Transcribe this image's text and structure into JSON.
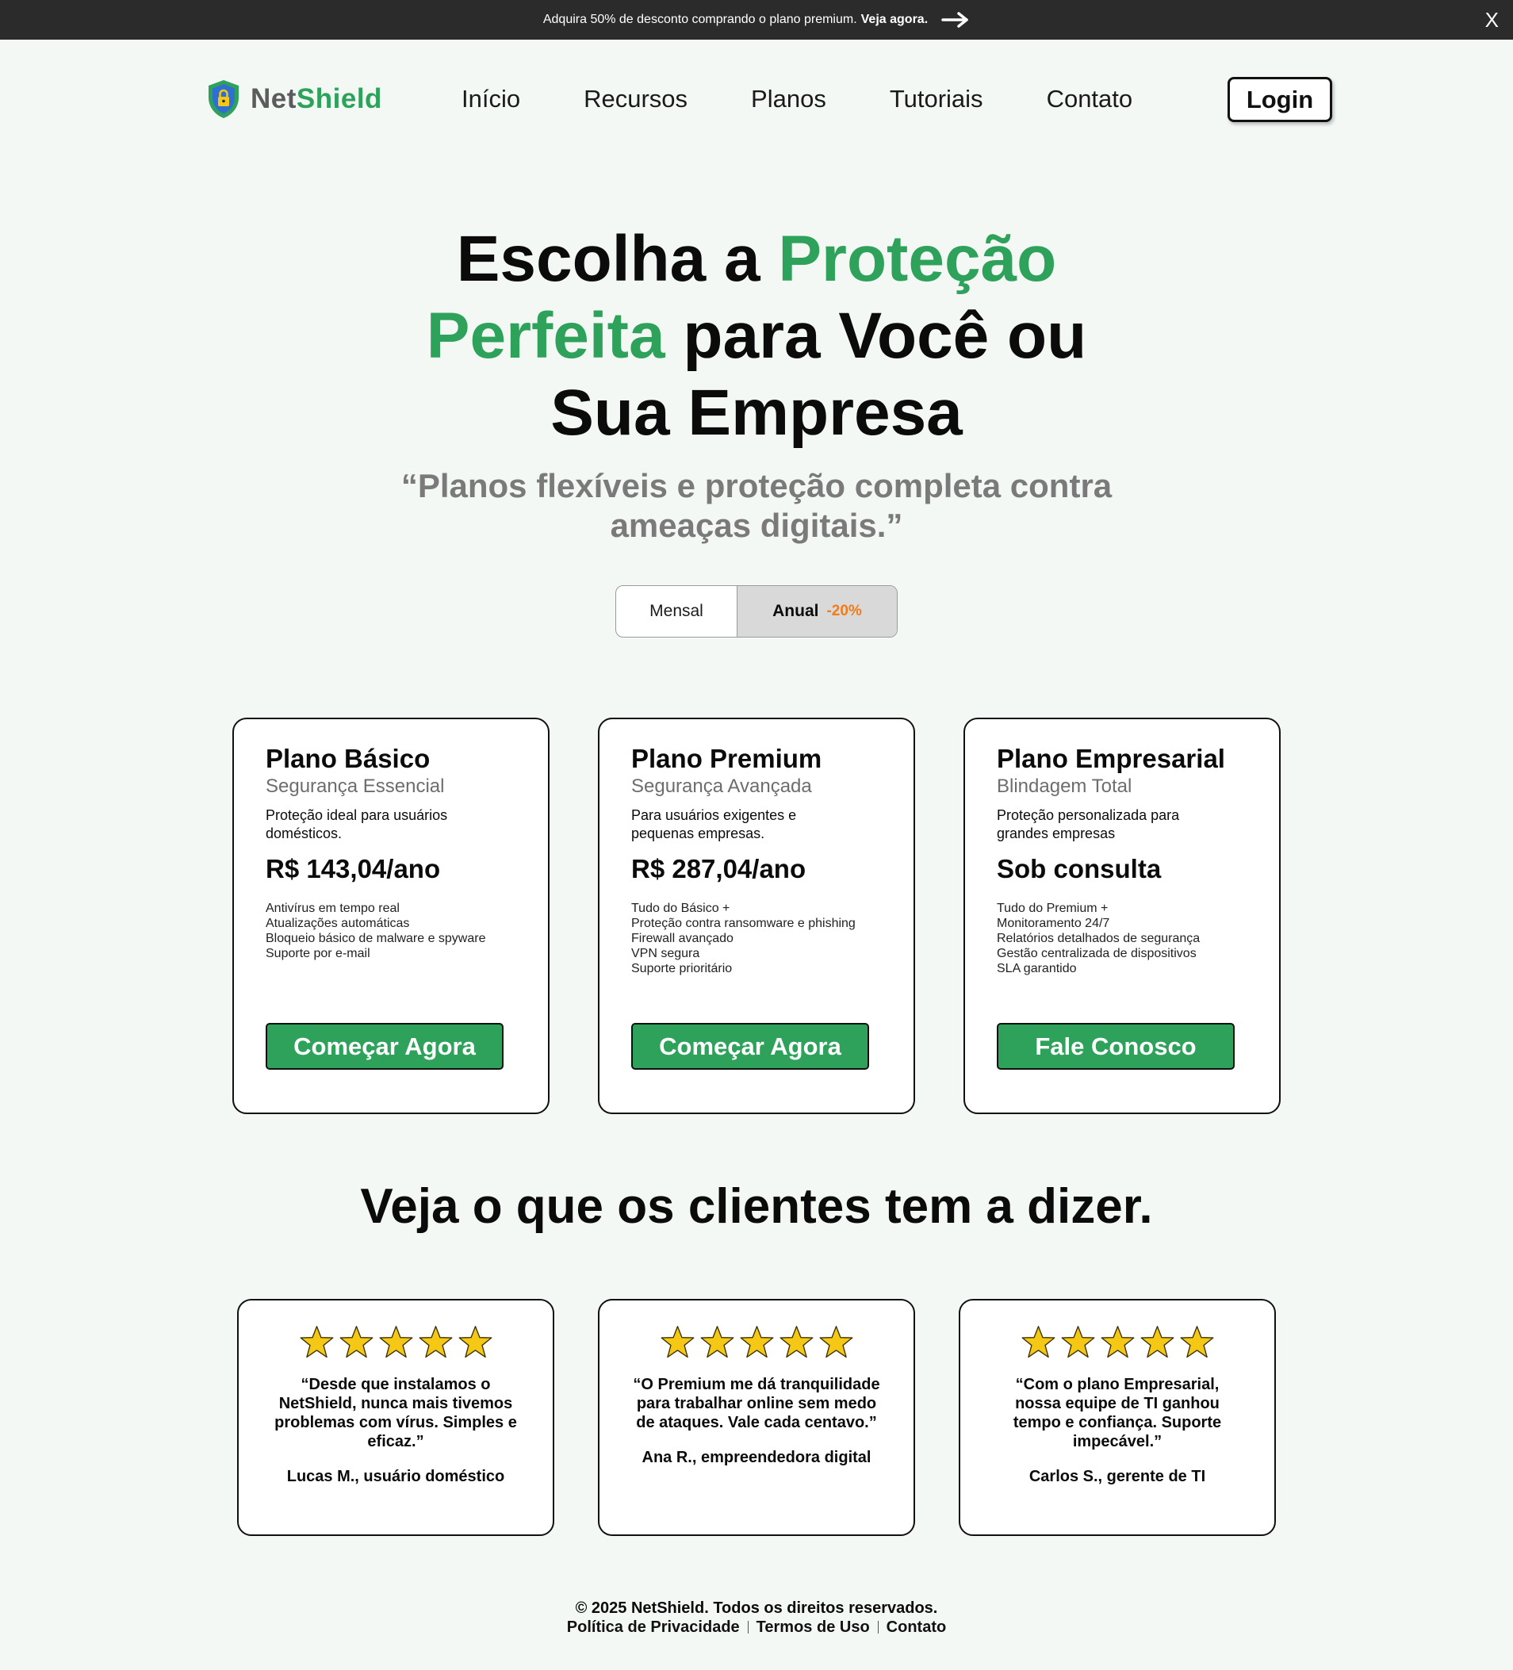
{
  "promo": {
    "text": "Adquira 50% de desconto comprando o plano premium.",
    "cta": "Veja agora.",
    "close_label": "X"
  },
  "logo": {
    "part1": "Net",
    "part2": "Shield"
  },
  "nav": {
    "items": [
      "Início",
      "Recursos",
      "Planos",
      "Tutoriais",
      "Contato"
    ],
    "login": "Login"
  },
  "hero": {
    "line1_a": "Escolha a ",
    "line1_b": "Proteção",
    "line2_a": "Perfeita",
    "line2_b": " para Você ou",
    "line3": "Sua Empresa",
    "subtitle": "“Planos flexíveis e proteção completa contra ameaças digitais.”"
  },
  "billing_toggle": {
    "monthly": "Mensal",
    "annual": "Anual",
    "annual_discount": "-20%",
    "selected": "Anual"
  },
  "plans": [
    {
      "name": "Plano Básico",
      "tagline": "Segurança Essencial",
      "description": "Proteção ideal para usuários domésticos.",
      "price": "R$ 143,04/ano",
      "features": [
        "Antivírus em tempo real",
        "Atualizações automáticas",
        "Bloqueio básico de malware e spyware",
        "Suporte por e-mail"
      ],
      "button": "Começar Agora"
    },
    {
      "name": "Plano Premium",
      "tagline": "Segurança Avançada",
      "description": "Para usuários exigentes e pequenas empresas.",
      "price": "R$ 287,04/ano",
      "features": [
        "Tudo do Básico +",
        "Proteção contra ransomware e phishing",
        "Firewall avançado",
        "VPN segura",
        "Suporte prioritário"
      ],
      "button": "Começar Agora"
    },
    {
      "name": "Plano Empresarial",
      "tagline": "Blindagem Total",
      "description": "Proteção personalizada para grandes empresas",
      "price": "Sob consulta",
      "features": [
        "Tudo do Premium +",
        "Monitoramento 24/7",
        "Relatórios detalhados de segurança",
        "Gestão centralizada de dispositivos",
        "SLA garantido"
      ],
      "button": "Fale Conosco"
    }
  ],
  "testimonials": {
    "title": "Veja o que os clientes tem a dizer.",
    "items": [
      {
        "rating": 5,
        "quote": "“Desde que instalamos o NetShield, nunca mais tivemos problemas com vírus. Simples e eficaz.”",
        "author": "Lucas M., usuário doméstico"
      },
      {
        "rating": 5,
        "quote": "“O Premium me dá tranquilidade para trabalhar online sem medo de ataques. Vale cada centavo.”",
        "author": "Ana R., empreendedora digital"
      },
      {
        "rating": 5,
        "quote": "“Com o plano Empresarial, nossa equipe de TI ganhou tempo e confiança. Suporte impecável.”",
        "author": "Carlos S., gerente de TI"
      }
    ]
  },
  "footer": {
    "copyright": "© 2025 NetShield. Todos os direitos reservados.",
    "links": [
      "Política de Privacidade",
      "Termos de Uso",
      "Contato"
    ]
  },
  "colors": {
    "brand_green": "#2ea25a",
    "promo_bg": "#2b2b2b",
    "page_bg": "#f3f8f5",
    "discount_orange": "#f07d1a",
    "star_yellow": "#f5c816"
  },
  "icons": {
    "logo": "shield-lock-icon",
    "promo_arrow": "arrow-right-icon",
    "rating": "star-icon"
  }
}
